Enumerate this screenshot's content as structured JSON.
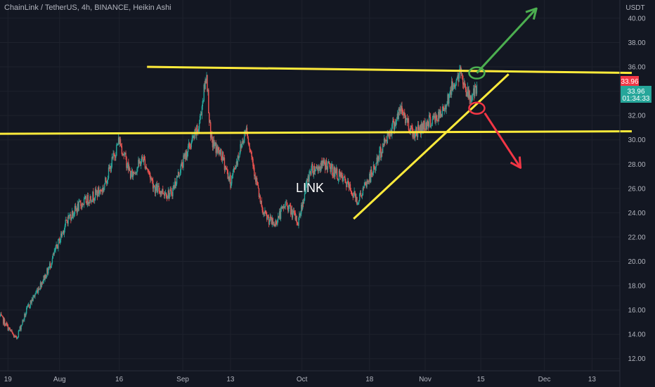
{
  "header": {
    "title": "ChainLink / TetherUS, 4h, BINANCE, Heikin Ashi"
  },
  "chart_data": {
    "type": "candlestick",
    "currency": "USDT",
    "watermark": "LINK",
    "ylim": [
      11,
      41.5
    ],
    "y_ticks": [
      12,
      14,
      16,
      18,
      20,
      22,
      24,
      26,
      28,
      30,
      32,
      34,
      36,
      38,
      40
    ],
    "x_range": [
      "2021-07-17",
      "2021-12-20"
    ],
    "x_ticks": [
      {
        "date": "2021-07-19",
        "label": "19"
      },
      {
        "date": "2021-08-01",
        "label": "Aug"
      },
      {
        "date": "2021-08-16",
        "label": "16"
      },
      {
        "date": "2021-09-01",
        "label": "Sep"
      },
      {
        "date": "2021-09-13",
        "label": "13"
      },
      {
        "date": "2021-10-01",
        "label": "Oct"
      },
      {
        "date": "2021-10-18",
        "label": "18"
      },
      {
        "date": "2021-11-01",
        "label": "Nov"
      },
      {
        "date": "2021-11-15",
        "label": "15"
      },
      {
        "date": "2021-12-01",
        "label": "Dec"
      },
      {
        "date": "2021-12-13",
        "label": "13"
      }
    ],
    "series_anchors": [
      [
        "2021-07-17",
        15.5
      ],
      [
        "2021-07-21",
        13.6
      ],
      [
        "2021-07-24",
        16.2
      ],
      [
        "2021-07-29",
        19.2
      ],
      [
        "2021-08-03",
        23.5
      ],
      [
        "2021-08-06",
        24.6
      ],
      [
        "2021-08-12",
        26.0
      ],
      [
        "2021-08-16",
        30.0
      ],
      [
        "2021-08-19",
        27.0
      ],
      [
        "2021-08-22",
        28.5
      ],
      [
        "2021-08-25",
        26.0
      ],
      [
        "2021-08-29",
        25.5
      ],
      [
        "2021-09-02",
        29.0
      ],
      [
        "2021-09-05",
        31.0
      ],
      [
        "2021-09-07",
        35.5
      ],
      [
        "2021-09-08",
        30.0
      ],
      [
        "2021-09-11",
        28.5
      ],
      [
        "2021-09-13",
        26.5
      ],
      [
        "2021-09-17",
        31.0
      ],
      [
        "2021-09-21",
        24.0
      ],
      [
        "2021-09-24",
        23.0
      ],
      [
        "2021-09-27",
        24.8
      ],
      [
        "2021-09-30",
        23.2
      ],
      [
        "2021-10-03",
        27.5
      ],
      [
        "2021-10-07",
        28.0
      ],
      [
        "2021-10-12",
        26.5
      ],
      [
        "2021-10-15",
        25.0
      ],
      [
        "2021-10-19",
        27.5
      ],
      [
        "2021-10-22",
        30.0
      ],
      [
        "2021-10-26",
        32.5
      ],
      [
        "2021-10-29",
        30.5
      ],
      [
        "2021-11-02",
        31.5
      ],
      [
        "2021-11-05",
        32.0
      ],
      [
        "2021-11-08",
        34.5
      ],
      [
        "2021-11-10",
        35.5
      ],
      [
        "2021-11-12",
        33.5
      ],
      [
        "2021-11-14",
        33.96
      ]
    ],
    "current_price": {
      "label": "33.96",
      "countdown": "01:34:33",
      "color": "#26a69a",
      "marker_color": "#f23645"
    },
    "annotations": {
      "horizontal_lines": [
        {
          "from": [
            "2021-08-23",
            36.0
          ],
          "to": [
            "2021-12-23",
            35.5
          ],
          "color": "#ffeb3b"
        },
        {
          "from": [
            "2021-07-17",
            30.5
          ],
          "to": [
            "2021-12-23",
            30.7
          ],
          "color": "#ffeb3b"
        }
      ],
      "trendline": {
        "from": [
          "2021-10-14",
          23.5
        ],
        "to": [
          "2021-11-22",
          35.4
        ],
        "color": "#ffeb3b"
      },
      "ellipses": [
        {
          "center": [
            "2021-11-14",
            35.5
          ],
          "color": "#4caf50"
        },
        {
          "center": [
            "2021-11-14",
            32.6
          ],
          "color": "#f23645"
        }
      ],
      "arrows": [
        {
          "from": [
            "2021-11-14",
            35.5
          ],
          "to": [
            "2021-11-29",
            40.8
          ],
          "color": "#4caf50"
        },
        {
          "from": [
            "2021-11-16",
            32.2
          ],
          "to": [
            "2021-11-25",
            27.7
          ],
          "color": "#f23645"
        }
      ]
    },
    "colors": {
      "up": "#26a69a",
      "down": "#ef5350",
      "grid": "#1e222d",
      "text": "#b2b5be",
      "background": "#131722"
    }
  }
}
